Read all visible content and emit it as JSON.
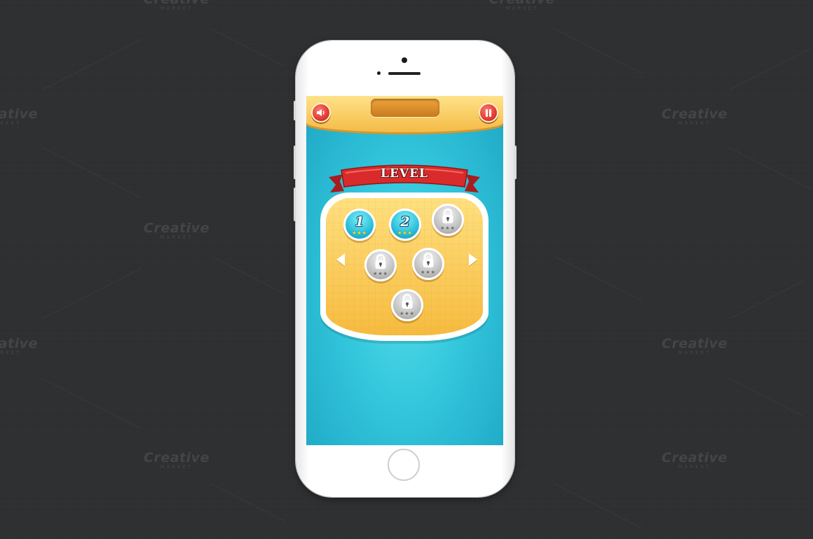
{
  "watermark": {
    "brand": "Creative",
    "sub": "MARKET"
  },
  "game": {
    "title": "LEVEL",
    "top_bar": {
      "sound_icon": "speaker-icon",
      "pause_icon": "pause-icon"
    },
    "levels": [
      {
        "number": "1",
        "status": "unlocked",
        "stars": "★★★"
      },
      {
        "number": "2",
        "status": "unlocked",
        "stars": "★★★"
      },
      {
        "number": "",
        "status": "locked",
        "stars": "★★★"
      },
      {
        "number": "",
        "status": "locked",
        "stars": "★★★"
      },
      {
        "number": "",
        "status": "locked",
        "stars": "★★★"
      },
      {
        "number": "",
        "status": "locked",
        "stars": "★★★"
      }
    ],
    "nav": {
      "prev_icon": "arrow-left-icon",
      "next_icon": "arrow-right-icon"
    }
  },
  "colors": {
    "background": "#2e2f31",
    "screen_blue": "#32c6dc",
    "panel_yellow": "#f6bb3f",
    "ribbon_red": "#d92b2b",
    "button_red": "#e23a33"
  }
}
